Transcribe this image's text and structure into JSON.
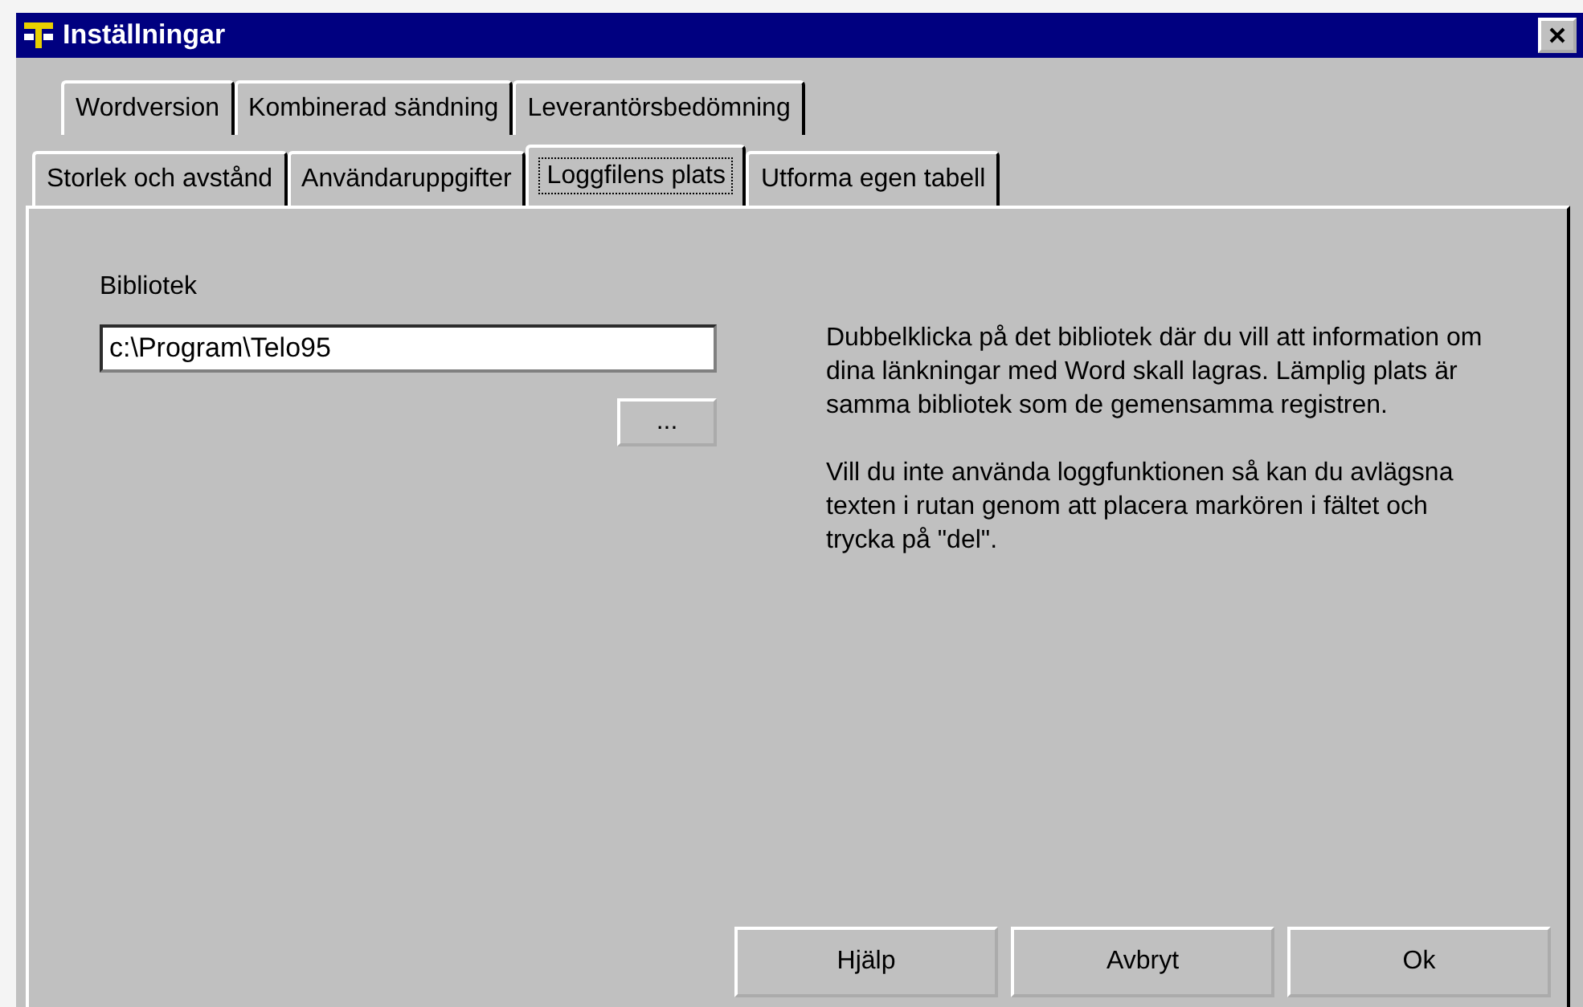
{
  "window": {
    "title": "Inställningar"
  },
  "tab_rows": [
    [
      {
        "label": "Wordversion",
        "selected": false
      },
      {
        "label": "Kombinerad sändning",
        "selected": false
      },
      {
        "label": "Leverantörsbedömning",
        "selected": false
      }
    ],
    [
      {
        "label": "Storlek och avstånd",
        "selected": false
      },
      {
        "label": "Användaruppgifter",
        "selected": false
      },
      {
        "label": "Loggfilens plats",
        "selected": true
      },
      {
        "label": "Utforma egen tabell",
        "selected": false
      }
    ]
  ],
  "folder": {
    "label": "Bibliotek",
    "value": "c:\\Program\\Telo95",
    "browse_button": "..."
  },
  "help_paragraphs": [
    "Dubbelklicka på det bibliotek där du vill att information om dina länkningar med Word skall lagras. Lämplig plats är samma bibliotek som de gemensamma registren.",
    "Vill du inte använda loggfunktionen så kan du avlägsna texten i rutan genom att placera markören i fältet och trycka på \"del\"."
  ],
  "buttons": [
    "Hjälp",
    "Avbryt",
    "Ok"
  ]
}
